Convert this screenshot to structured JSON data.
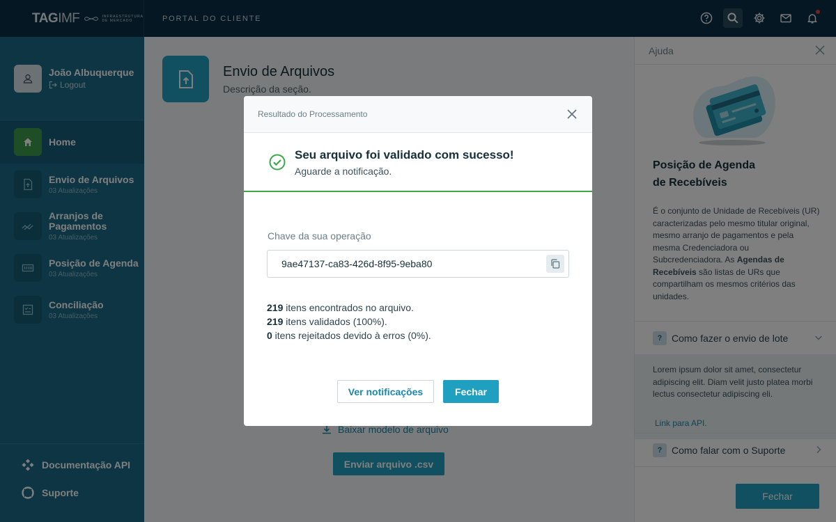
{
  "header": {
    "logo_tag": "TAG",
    "logo_imf": "IMF",
    "logo_sub_1": "INFRAESTRUTURA",
    "logo_sub_2": "DE MERCADO",
    "portal": "PORTAL DO CLIENTE",
    "icons": [
      "help-icon",
      "search-icon",
      "gear-icon",
      "mail-icon",
      "bell-icon"
    ]
  },
  "sidebar": {
    "user_name": "João Albuquerque",
    "logout": "Logout",
    "items": [
      {
        "label": "Home",
        "sub": "",
        "icon": "home-icon"
      },
      {
        "label": "Envio de Arquivos",
        "sub": "03 Atualizações",
        "icon": "file-upload-icon"
      },
      {
        "label": "Arranjos de Pagamentos",
        "sub": "03 Atualizações",
        "icon": "payments-icon"
      },
      {
        "label": "Posição de Agenda",
        "sub": "03 Atualizações",
        "icon": "agenda-icon"
      },
      {
        "label": "Conciliação",
        "sub": "03 Atualizações",
        "icon": "conciliation-icon"
      }
    ],
    "bottom": [
      {
        "label": "Documentação API",
        "icon": "api-icon"
      },
      {
        "label": "Suporte",
        "icon": "lifebuoy-icon"
      }
    ]
  },
  "main": {
    "title": "Envio de Arquivos",
    "description": "Descrição da seção.",
    "download_link": "Baixar modelo de arquivo",
    "send_button": "Enviar arquivo .csv"
  },
  "help": {
    "header": "Ajuda",
    "title_line1": "Posição de Agenda",
    "title_line2": "de Recebíveis",
    "text_1": "É o conjunto de Unidade de Recebíveis (UR) caracterizadas pelo mesmo titular original, mesmo arranjo de pagamentos e pela mesma Credenciadora ou Subcredenciadora. As ",
    "text_bold": "Agendas de Recebíveis",
    "text_2": " são listas de URs que compartilham os mesmos critérios das unidades.",
    "accordion": [
      {
        "badge": "?",
        "title": "Como fazer o envio de lote",
        "body": "Lorem ipsum dolor sit amet, consectetur adipiscing elit. Diam velit justo platea morbi lectus consectetur adipiscing eli.",
        "link": "Link para API."
      },
      {
        "badge": "?",
        "title": "Como falar com o Suporte"
      }
    ],
    "close_button": "Fechar"
  },
  "modal": {
    "header": "Resultado do Processamento",
    "success_title": "Seu arquivo foi validado com sucesso!",
    "success_sub": "Aguarde a notificação.",
    "key_label": "Chave da sua operação",
    "key_value": "9ae47137-ca83-426d-8f95-9eba80",
    "stats": [
      {
        "count": "219",
        "text": " itens encontrados no arquivo."
      },
      {
        "count": "219",
        "text": " itens validados (100%)."
      },
      {
        "count": "0",
        "text": " itens rejeitados devido à erros (0%)."
      }
    ],
    "btn_notifications": "Ver notificações",
    "btn_close": "Fechar"
  },
  "colors": {
    "topbar": "#0a2f44",
    "sidebar": "#1a6b87",
    "primary": "#20a0c0",
    "success": "#3ba84a",
    "notification": "#e2423d"
  }
}
